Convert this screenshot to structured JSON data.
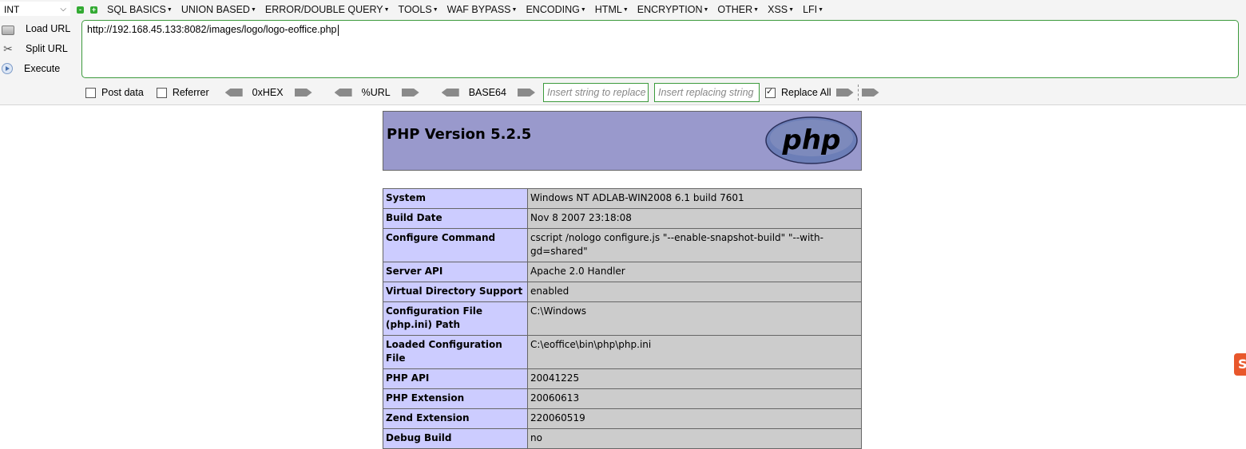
{
  "hackbar": {
    "mode_value": "INT",
    "menu": [
      "SQL BASICS",
      "UNION BASED",
      "ERROR/DOUBLE QUERY",
      "TOOLS",
      "WAF BYPASS",
      "ENCODING",
      "HTML",
      "ENCRYPTION",
      "OTHER",
      "XSS",
      "LFI"
    ],
    "load_url_label": "Load URL",
    "split_url_label": "Split URL",
    "execute_label": "Execute",
    "url_value": "http://192.168.45.133:8082/images/logo/logo-eoffice.php",
    "post_data_label": "Post data",
    "referrer_label": "Referrer",
    "hex_label": "0xHEX",
    "url_enc_label": "%URL",
    "base64_label": "BASE64",
    "insert_replace_placeholder": "Insert string to replace",
    "insert_replacing_placeholder": "Insert replacing string",
    "replace_all_label": "Replace All",
    "post_data_checked": false,
    "referrer_checked": false,
    "replace_all_checked": true
  },
  "phpinfo": {
    "title": "PHP Version 5.2.5",
    "logo_text": "php",
    "rows": [
      {
        "key": "System",
        "value": "Windows NT ADLAB-WIN2008 6.1 build 7601"
      },
      {
        "key": "Build Date",
        "value": "Nov 8 2007 23:18:08"
      },
      {
        "key": "Configure Command",
        "value": "cscript /nologo configure.js \"--enable-snapshot-build\" \"--with-gd=shared\""
      },
      {
        "key": "Server API",
        "value": "Apache 2.0 Handler"
      },
      {
        "key": "Virtual Directory Support",
        "value": "enabled"
      },
      {
        "key": "Configuration File (php.ini) Path",
        "value": "C:\\Windows"
      },
      {
        "key": "Loaded Configuration File",
        "value": "C:\\eoffice\\bin\\php\\php.ini"
      },
      {
        "key": "PHP API",
        "value": "20041225"
      },
      {
        "key": "PHP Extension",
        "value": "20060613"
      },
      {
        "key": "Zend Extension",
        "value": "220060519"
      },
      {
        "key": "Debug Build",
        "value": "no"
      }
    ]
  },
  "colors": {
    "header_bg": "#9999cc",
    "key_bg": "#ccccff",
    "value_bg": "#cccccc",
    "accent_green": "#3c9a3c"
  }
}
